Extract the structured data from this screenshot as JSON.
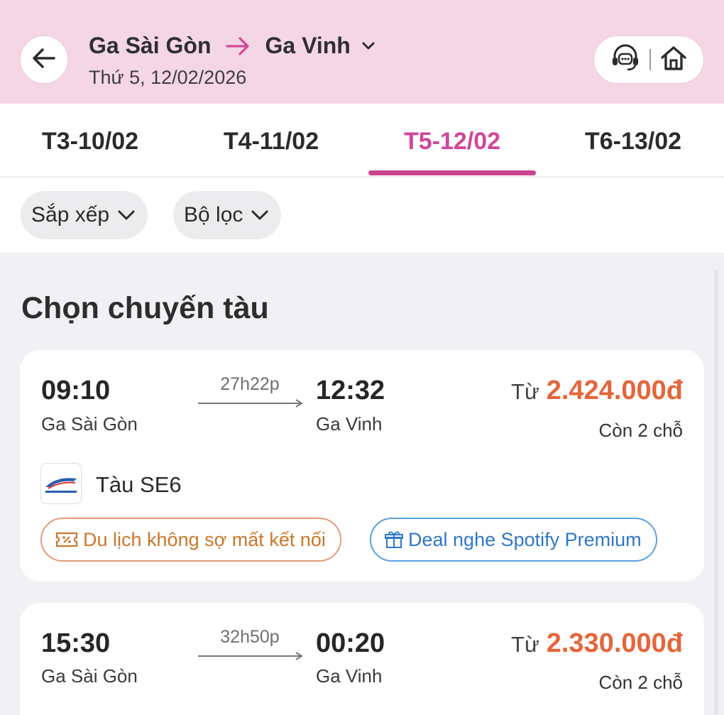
{
  "header": {
    "origin": "Ga Sài Gòn",
    "destination": "Ga Vinh",
    "date": "Thứ 5, 12/02/2026"
  },
  "tabs": [
    {
      "label": "T3-10/02",
      "active": false
    },
    {
      "label": "T4-11/02",
      "active": false
    },
    {
      "label": "T5-12/02",
      "active": true
    },
    {
      "label": "T6-13/02",
      "active": false
    }
  ],
  "filters": {
    "sort_label": "Sắp xếp",
    "filter_label": "Bộ lọc"
  },
  "section_title": "Chọn chuyến tàu",
  "trains": [
    {
      "departure_time": "09:10",
      "departure_station": "Ga Sài Gòn",
      "duration": "27h22p",
      "arrival_time": "12:32",
      "arrival_station": "Ga Vinh",
      "price_prefix": "Từ",
      "price": "2.424.000đ",
      "seats": "Còn 2 chỗ",
      "train_name": "Tàu SE6",
      "tags": [
        "Du lịch không sợ mất kết nối",
        "Deal nghe Spotify Premium"
      ]
    },
    {
      "departure_time": "15:30",
      "departure_station": "Ga Sài Gòn",
      "duration": "32h50p",
      "arrival_time": "00:20",
      "arrival_station": "Ga Vinh",
      "price_prefix": "Từ",
      "price": "2.330.000đ",
      "seats": "Còn 2 chỗ"
    }
  ],
  "icons": {
    "back": "arrow-left-icon",
    "route_arrow": "arrow-right-icon",
    "dropdown": "chevron-down-icon",
    "support": "headset-chat-icon",
    "home": "home-icon",
    "tag_orange": "ticket-percent-icon",
    "tag_blue": "gift-icon",
    "train_logo": "vnr-logo"
  },
  "colors": {
    "header_bg": "#f4d6e4",
    "accent_pink": "#d2479a",
    "price_orange": "#e4663a",
    "tag_orange": "#c9772a",
    "tag_blue": "#2f77c8"
  }
}
